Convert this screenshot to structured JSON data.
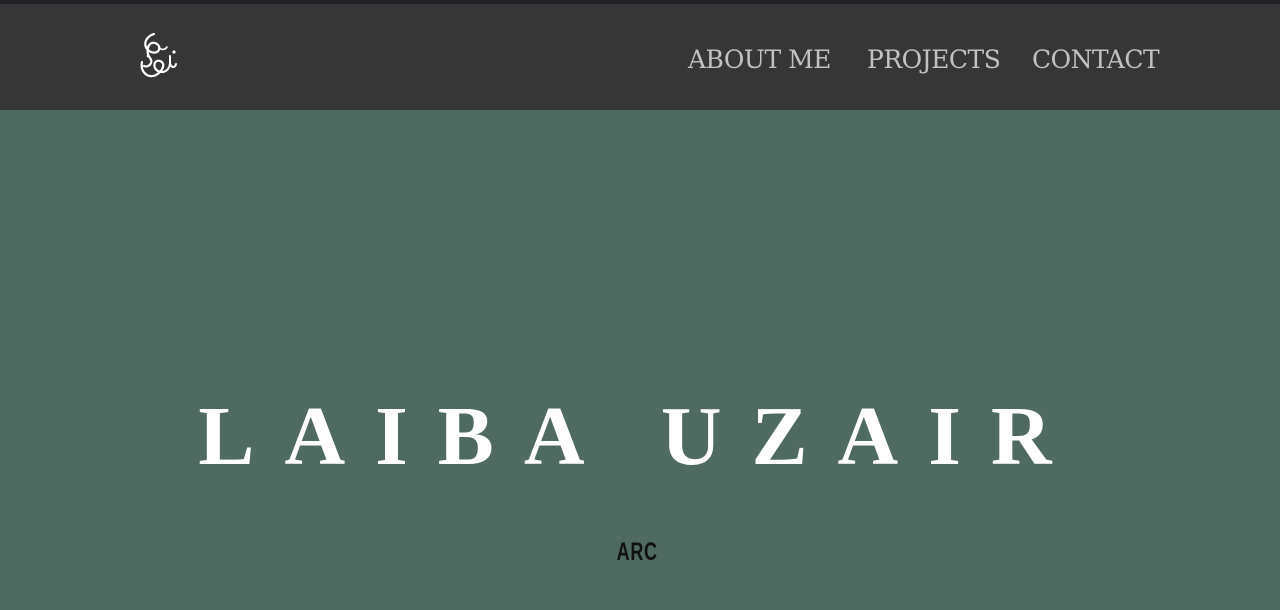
{
  "header": {
    "logo_icon": "arabic-calligraphy-logo-icon",
    "nav": [
      {
        "label": "ABOUT ME"
      },
      {
        "label": "PROJECTS"
      },
      {
        "label": "CONTACT"
      }
    ]
  },
  "hero": {
    "title": "LAIBA UZAIR",
    "subtitle": "ARC"
  },
  "colors": {
    "navbar_bg": "#363636",
    "hero_bg": "#4f6b61",
    "nav_text": "#c2c2c2",
    "title_text": "#ffffff",
    "subtitle_text": "#111111"
  }
}
